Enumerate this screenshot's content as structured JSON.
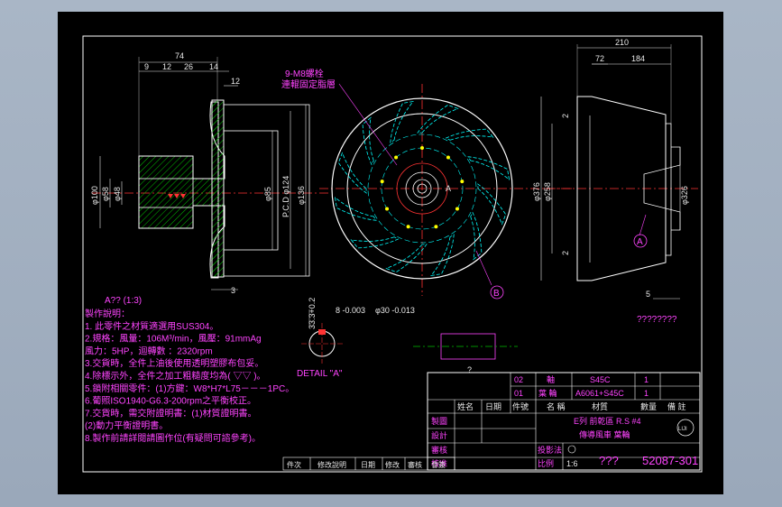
{
  "colors": {
    "background": "#000000",
    "outline": "#ffffff",
    "hatch": "#00c000",
    "dimension": "#e8e8e8",
    "center_line": "#ff3333",
    "blade": "#00ffff",
    "bolt_circle": "#00ffff",
    "note_text": "#ff44ff",
    "title_text": "#ff44ff"
  },
  "front_view": {
    "dims_top": [
      "74",
      "9",
      "12",
      "26",
      "14",
      "12"
    ],
    "dims_vertical": [
      "φ100",
      "φ58",
      "φ48",
      "φ85",
      "P.C.D φ124",
      "φ136"
    ],
    "dim_bottom": "3",
    "caption": "A?? (1:3)"
  },
  "circle_view": {
    "bolt_callout_line1": "9-M8螺栓",
    "bolt_callout_line2": "連輥固定脂層",
    "balloon": "B",
    "center_label": "A"
  },
  "right_view": {
    "dims_top": [
      "210",
      "72",
      "184"
    ],
    "dims_left": [
      "φ376",
      "φ258"
    ],
    "dims_small": [
      "2",
      "2"
    ],
    "dim_right": "φ326",
    "dim_bottom": "5",
    "balloon": "A",
    "part_caption": "????????"
  },
  "detail": {
    "tol_top": "33.3+0.2",
    "tol_key": "8 -0.003",
    "tol_bore": "φ30 -0.013",
    "label": "DETAIL  \"A\"",
    "question": "?"
  },
  "notes": [
    "製作說明：",
    "1. 此零件之材質適選用SUS304。",
    "2.規格：風量：106M³/min，風壓：91mmAg",
    "        風力：5HP，迴轉數  ：2320rpm",
    "3.交貨時，全件上油後使用透明塑膠布包妥。",
    "4.除標示外，全件之加工粗糙度均為(  ▽▽  )。",
    "5.鎖附相關零件：(1)方鍵：W8*H7*L75－－－1PC。",
    "6.葡照ISO1940-G6.3-200rpm之平衡校正。",
    "7.交貨時，需交附證明書：(1)材質證明書。",
    "                            (2)動力平衡證明書。",
    "8.製作前請詳閱請圖作位(有疑問可諮參考)。"
  ],
  "title_block": {
    "parts_list": [
      {
        "no": "02",
        "name": "軸",
        "material": "S45C",
        "qty": "1"
      },
      {
        "no": "01",
        "name": "葉 輪",
        "material": "A6061+S45C",
        "qty": "1"
      }
    ],
    "header": [
      "姓名",
      "日期",
      "件號",
      "名 稱",
      "材質",
      "數量",
      "備 註"
    ],
    "rows": [
      "製圖",
      "設計",
      "審核",
      "核准"
    ],
    "revision": [
      "件次",
      "修改說明",
      "日期",
      "修改",
      "審核",
      "會簽"
    ],
    "project_line": "E列 前乾區 R.S #4",
    "drawing_name": "傳導風車    葉輪",
    "logo": "LIJI",
    "projection_label": "投影法",
    "scale_label": "比例",
    "scale_value": "1:6",
    "drawing_no_prefix": "???",
    "drawing_no": "52087-301"
  }
}
